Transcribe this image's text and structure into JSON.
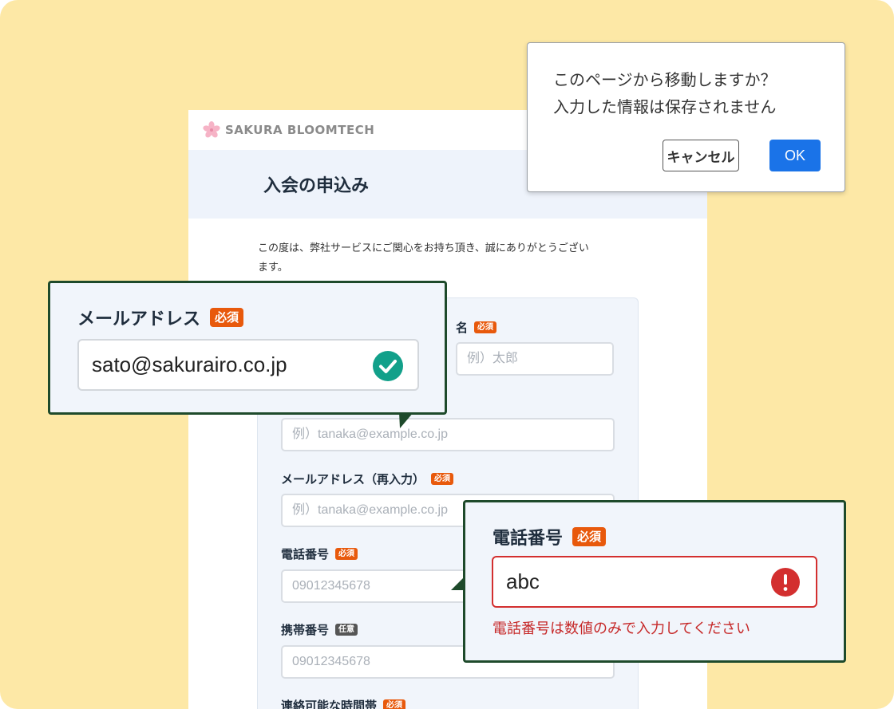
{
  "brand": {
    "name": "SAKURA BLOOMTECH"
  },
  "page": {
    "title": "入会の申込み",
    "intro_line1": "この度は、弊社サービスにご関心をお持ち頂き、誠にありがとうござい",
    "intro_line2": "ます。"
  },
  "form": {
    "given_name": {
      "label": "名",
      "badge": "必須",
      "placeholder": "例）太郎"
    },
    "email": {
      "placeholder": "例）tanaka@example.co.jp"
    },
    "email_confirm": {
      "label": "メールアドレス（再入力）",
      "badge": "必須",
      "placeholder": "例）tanaka@example.co.jp"
    },
    "phone": {
      "label": "電話番号",
      "badge": "必須",
      "placeholder": "09012345678"
    },
    "mobile": {
      "label": "携帯番号",
      "badge": "任意",
      "placeholder": "09012345678"
    },
    "contact_time": {
      "label": "連絡可能な時間帯",
      "badge": "必須"
    }
  },
  "dialog": {
    "line1": "このページから移動しますか？",
    "line2": "入力した情報は保存されません",
    "cancel_label": "キャンセル",
    "ok_label": "OK"
  },
  "email_callout": {
    "label": "メールアドレス",
    "badge": "必須",
    "value": "sato@sakurairo.co.jp",
    "status_icon": "check-circle-icon"
  },
  "phone_callout": {
    "label": "電話番号",
    "badge": "必須",
    "value": "abc",
    "status_icon": "error-circle-icon",
    "error_message": "電話番号は数値のみで入力してください"
  },
  "colors": {
    "background": "#fde8a6",
    "required_badge": "#e8590c",
    "ok_button": "#1a73e8",
    "success": "#12a08a",
    "error": "#c62828",
    "callout_border": "#1e4a2b"
  }
}
